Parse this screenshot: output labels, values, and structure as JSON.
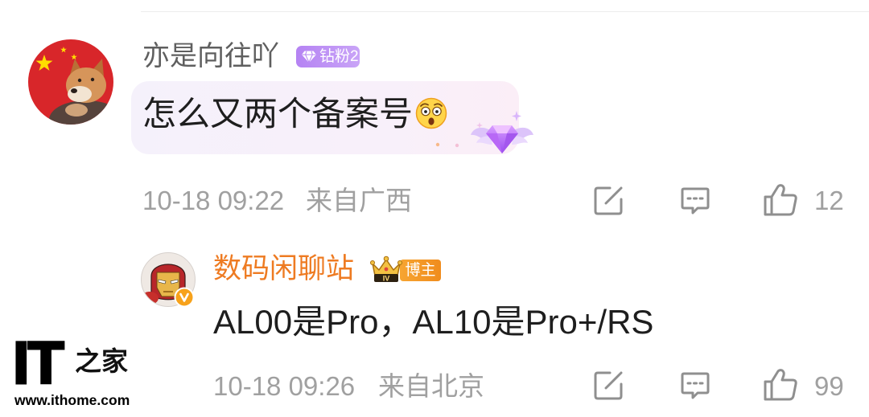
{
  "comment": {
    "avatar_icon": "user-avatar-flag-dog",
    "username": "亦是向往吖",
    "badge": {
      "icon": "diamond-icon",
      "label": "钻粉2"
    },
    "text": "怎么又两个备案号",
    "emoji_icon": "astonished-face-emoji",
    "decoration_icon": "winged-diamond-icon",
    "time": "10-18 09:22",
    "location": "来自广西",
    "actions": {
      "share_icon": "share-icon",
      "comment_icon": "comment-icon",
      "like_icon": "like-icon"
    },
    "like_count": "12"
  },
  "reply": {
    "avatar_icon": "user-avatar-iron-man",
    "verified_icon": "verified-badge-icon",
    "username": "数码闲聊站",
    "crown_badge": {
      "icon": "crown-icon",
      "level": "IV"
    },
    "role_badge": "博主",
    "text": "AL00是Pro，AL10是Pro+/RS",
    "time": "10-18 09:26",
    "location": "来自北京",
    "actions": {
      "share_icon": "share-icon",
      "comment_icon": "comment-icon",
      "like_icon": "like-icon"
    },
    "like_count": "99"
  },
  "watermark": {
    "logo": "IT",
    "logo_suffix": "之家",
    "url": "www.ithome.com"
  },
  "colors": {
    "username_gray": "#5f5f5f",
    "username_orange": "#ee7b22",
    "text_primary": "#1e1e1e",
    "meta_gray": "#a0a0a0",
    "icon_gray": "#8f8f8f",
    "fan_badge_purple": "#b583f3",
    "blogger_badge_orange": "#f08c1d",
    "divider": "#ededed"
  }
}
